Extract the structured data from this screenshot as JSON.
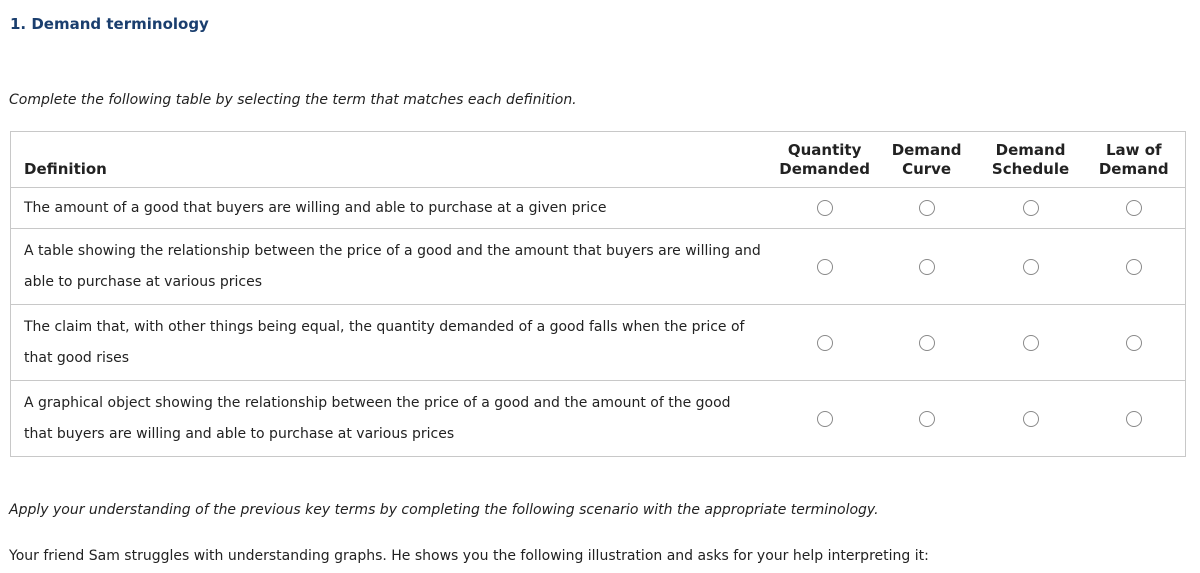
{
  "question": {
    "title": "1. Demand terminology",
    "instructions": "Complete the following table by selecting the term that matches each definition."
  },
  "table": {
    "definition_header": "Definition",
    "terms": [
      {
        "line1": "Quantity",
        "line2": "Demanded"
      },
      {
        "line1": "Demand",
        "line2": "Curve"
      },
      {
        "line1": "Demand",
        "line2": "Schedule"
      },
      {
        "line1": "Law of",
        "line2": "Demand"
      }
    ],
    "rows": [
      {
        "definition": "The amount of a good that buyers are willing and able to purchase at a given price",
        "selected": null
      },
      {
        "definition": "A table showing the relationship between the price of a good and the amount that buyers are willing and able to purchase at various prices",
        "selected": null
      },
      {
        "definition": "The claim that, with other things being equal, the quantity demanded of a good falls when the price of that good rises",
        "selected": null
      },
      {
        "definition": "A graphical object showing the relationship between the price of a good and the amount of the good that buyers are willing and able to purchase at various prices",
        "selected": null
      }
    ]
  },
  "scenario": {
    "apply_instructions": "Apply your understanding of the previous key terms by completing the following scenario with the appropriate terminology.",
    "intro": "Your friend Sam struggles with understanding graphs. He shows you the following illustration and asks for your help interpreting it:"
  },
  "colors": {
    "title": "#1a3e6e",
    "border": "#c8c8c8",
    "radio_border": "#8a8a8a"
  }
}
